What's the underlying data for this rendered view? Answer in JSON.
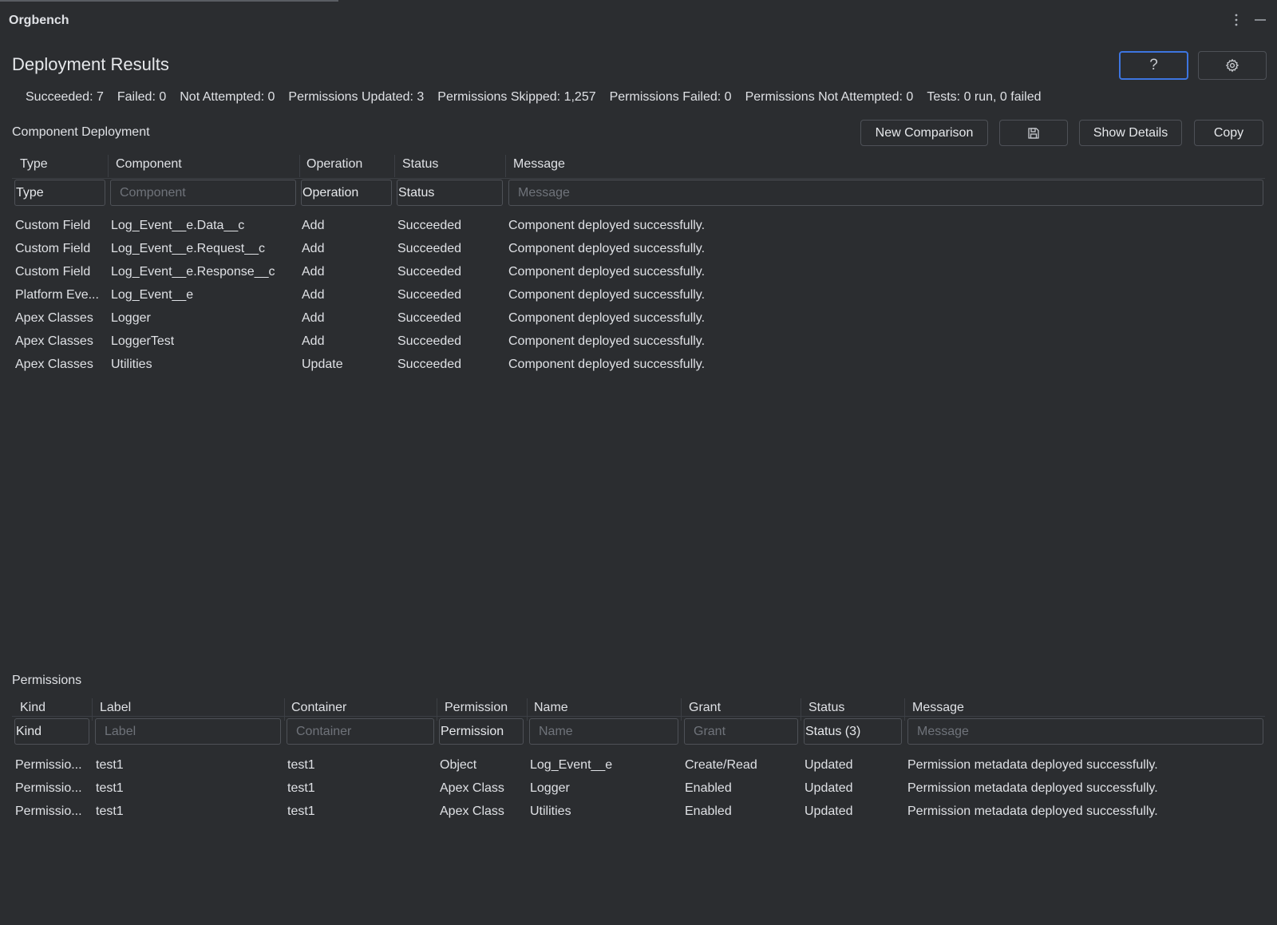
{
  "window": {
    "title": "Orgbench"
  },
  "header": {
    "title": "Deployment Results",
    "help_glyph": "?",
    "summary": [
      "Succeeded: 7",
      "Failed: 0",
      "Not Attempted: 0",
      "Permissions Updated: 3",
      "Permissions Skipped: 1,257",
      "Permissions Failed: 0",
      "Permissions Not Attempted: 0",
      "Tests: 0 run, 0 failed"
    ]
  },
  "components": {
    "section_label": "Component Deployment",
    "buttons": {
      "new_comparison": "New Comparison",
      "show_details": "Show Details",
      "copy": "Copy"
    },
    "columns": [
      "Type",
      "Component",
      "Operation",
      "Status",
      "Message"
    ],
    "filters": {
      "type": "Type",
      "component": "",
      "operation": "Operation",
      "status": "Status",
      "message": ""
    },
    "placeholders": {
      "type": "Type",
      "component": "Component",
      "operation": "Operation",
      "status": "Status",
      "message": "Message"
    },
    "rows": [
      [
        "Custom Field",
        "Log_Event__e.Data__c",
        "Add",
        "Succeeded",
        "Component deployed successfully."
      ],
      [
        "Custom Field",
        "Log_Event__e.Request__c",
        "Add",
        "Succeeded",
        "Component deployed successfully."
      ],
      [
        "Custom Field",
        "Log_Event__e.Response__c",
        "Add",
        "Succeeded",
        "Component deployed successfully."
      ],
      [
        "Platform Eve...",
        "Log_Event__e",
        "Add",
        "Succeeded",
        "Component deployed successfully."
      ],
      [
        "Apex Classes",
        "Logger",
        "Add",
        "Succeeded",
        "Component deployed successfully."
      ],
      [
        "Apex Classes",
        "LoggerTest",
        "Add",
        "Succeeded",
        "Component deployed successfully."
      ],
      [
        "Apex Classes",
        "Utilities",
        "Update",
        "Succeeded",
        "Component deployed successfully."
      ]
    ]
  },
  "permissions": {
    "section_label": "Permissions",
    "columns": [
      "Kind",
      "Label",
      "Container",
      "Permission",
      "Name",
      "Grant",
      "Status",
      "Message"
    ],
    "filters": {
      "kind": "Kind",
      "label": "",
      "container": "",
      "permission": "Permission",
      "name": "",
      "grant": "",
      "status": "Status (3)",
      "message": ""
    },
    "placeholders": {
      "kind": "Kind",
      "label": "Label",
      "container": "Container",
      "permission": "Permission",
      "name": "Name",
      "grant": "Grant",
      "status": "Status",
      "message": "Message"
    },
    "rows": [
      [
        "Permissio...",
        "test1",
        "test1",
        "Object",
        "Log_Event__e",
        "Create/Read",
        "Updated",
        "Permission metadata deployed successfully."
      ],
      [
        "Permissio...",
        "test1",
        "test1",
        "Apex Class",
        "Logger",
        "Enabled",
        "Updated",
        "Permission metadata deployed successfully."
      ],
      [
        "Permissio...",
        "test1",
        "test1",
        "Apex Class",
        "Utilities",
        "Enabled",
        "Updated",
        "Permission metadata deployed successfully."
      ]
    ]
  },
  "icons": {
    "menu": "more-vertical-icon",
    "minimize": "minimize-icon",
    "help": "help-icon",
    "settings": "gear-icon",
    "save": "save-icon"
  }
}
